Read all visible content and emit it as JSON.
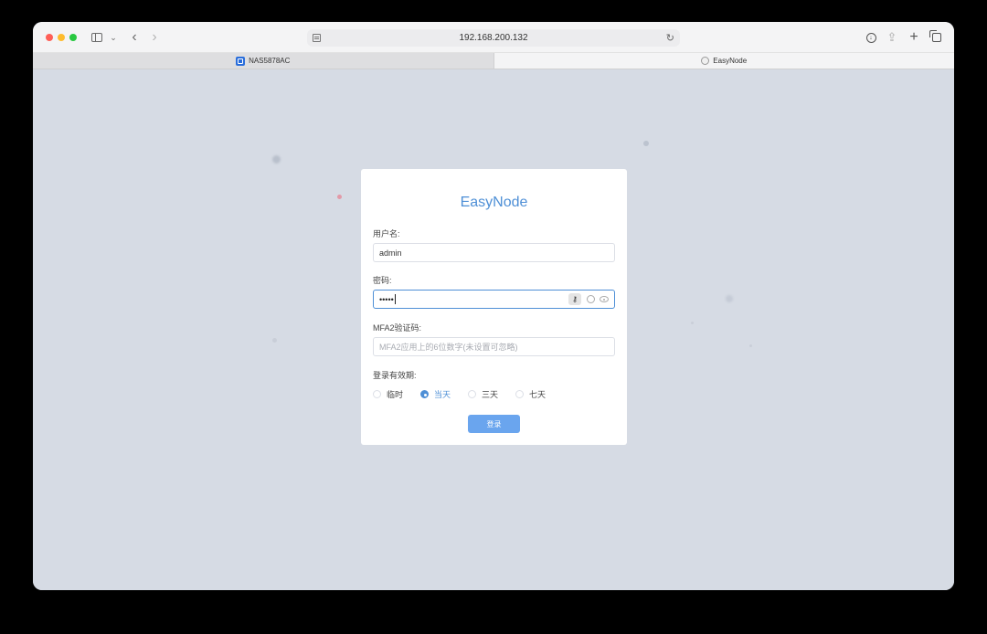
{
  "browser": {
    "url": "192.168.200.132",
    "tabs": [
      {
        "label": "NAS5878AC",
        "active": false
      },
      {
        "label": "EasyNode",
        "active": true
      }
    ]
  },
  "login": {
    "title": "EasyNode",
    "username_label": "用户名:",
    "username_value": "admin",
    "password_label": "密码:",
    "password_masked": "•••••",
    "mfa_label": "MFA2验证码:",
    "mfa_placeholder": "MFA2应用上的6位数字(未设置可忽略)",
    "validity_label": "登录有效期:",
    "validity_options": [
      {
        "label": "临时",
        "checked": false
      },
      {
        "label": "当天",
        "checked": true
      },
      {
        "label": "三天",
        "checked": false
      },
      {
        "label": "七天",
        "checked": false
      }
    ],
    "submit_label": "登录"
  },
  "colors": {
    "accent": "#4e8fd6",
    "button": "#6aa5ee",
    "background": "#d6dbe4"
  }
}
